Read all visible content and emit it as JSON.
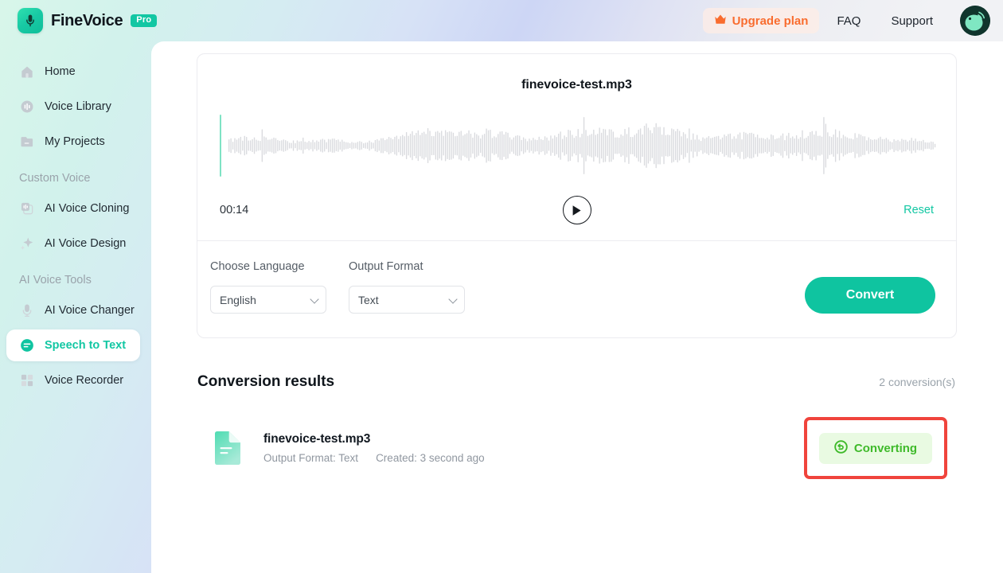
{
  "header": {
    "brand_name": "FineVoice",
    "pro_badge": "Pro",
    "upgrade_label": "Upgrade plan",
    "faq_label": "FAQ",
    "support_label": "Support"
  },
  "sidebar": {
    "items": [
      {
        "label": "Home",
        "icon": "home-icon",
        "active": false
      },
      {
        "label": "Voice Library",
        "icon": "waveform-icon",
        "active": false
      },
      {
        "label": "My Projects",
        "icon": "folder-icon",
        "active": false
      }
    ],
    "group_custom_voice": "Custom Voice",
    "custom_items": [
      {
        "label": "AI Voice Cloning",
        "icon": "clone-icon",
        "active": false
      },
      {
        "label": "AI Voice Design",
        "icon": "sparkle-icon",
        "active": false
      }
    ],
    "group_ai_tools": "AI Voice Tools",
    "tool_items": [
      {
        "label": "AI Voice Changer",
        "icon": "microphone-icon",
        "active": false
      },
      {
        "label": "Speech to Text",
        "icon": "speech-text-icon",
        "active": true
      },
      {
        "label": "Voice Recorder",
        "icon": "grid-icon",
        "active": false
      }
    ]
  },
  "player": {
    "file_title": "finevoice-test.mp3",
    "current_time": "00:14",
    "reset_label": "Reset",
    "play_icon": "play-icon"
  },
  "options": {
    "language_label": "Choose Language",
    "language_value": "English",
    "format_label": "Output Format",
    "format_value": "Text",
    "convert_label": "Convert"
  },
  "results": {
    "title": "Conversion results",
    "count_text": "2 conversion(s)",
    "rows": [
      {
        "name": "finevoice-test.mp3",
        "output_format": "Output Format: Text",
        "created": "Created: 3 second ago",
        "status": "Converting",
        "status_icon": "sync-icon"
      }
    ]
  },
  "colors": {
    "accent_teal": "#12c7a3",
    "upgrade_orange": "#f96c2e",
    "status_green": "#3fba2a",
    "status_bg": "#e9fae2",
    "highlight_red": "#f0443c"
  }
}
